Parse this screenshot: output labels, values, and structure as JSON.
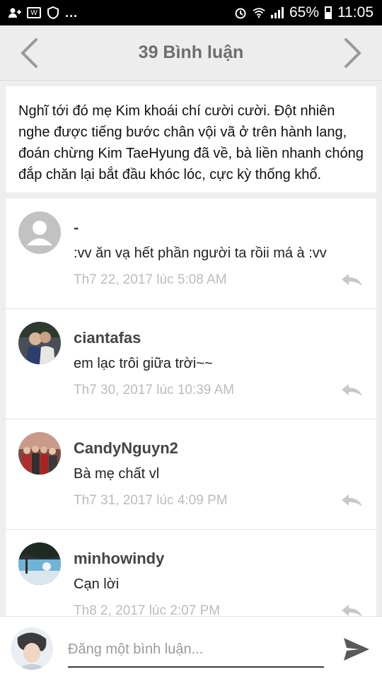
{
  "status_bar": {
    "battery": "65%",
    "time": "11:05",
    "dots": "..."
  },
  "header": {
    "title": "39 Bình luận"
  },
  "excerpt": {
    "text": "Nghĩ tới đó mẹ Kim khoái chí cười cười. Đột nhiên nghe được tiếng bước chân vội vã ở trên hành lang, đoán chừng Kim TaeHyung đã về, bà liền nhanh chóng đắp chăn lại bắt đầu khóc lóc, cực kỳ thống khổ."
  },
  "comments": [
    {
      "name": "-",
      "text": ":vv ăn vạ hết phần người ta rồii má à :vv",
      "time": "Th7 22, 2017 lúc 5:08 AM",
      "avatar": "default-avatar"
    },
    {
      "name": "ciantafas",
      "text": "em lạc trôi giữa trời~~",
      "time": "Th7 30, 2017 lúc 10:39 AM",
      "avatar": "photo-avatar"
    },
    {
      "name": "CandyNguyn2",
      "text": "Bà mẹ chất vl",
      "time": "Th7 31, 2017 lúc 4:09 PM",
      "avatar": "group-photo-avatar"
    },
    {
      "name": "minhowindy",
      "text": "Cạn lời",
      "time": "Th8 2, 2017 lúc 2:07 PM",
      "avatar": "landscape-avatar"
    }
  ],
  "composer": {
    "placeholder": "Đăng một bình luận..."
  },
  "colors": {
    "accent_text": "#6e6e6e",
    "timestamp": "#bbbbbb",
    "status_bar": "#000000"
  }
}
